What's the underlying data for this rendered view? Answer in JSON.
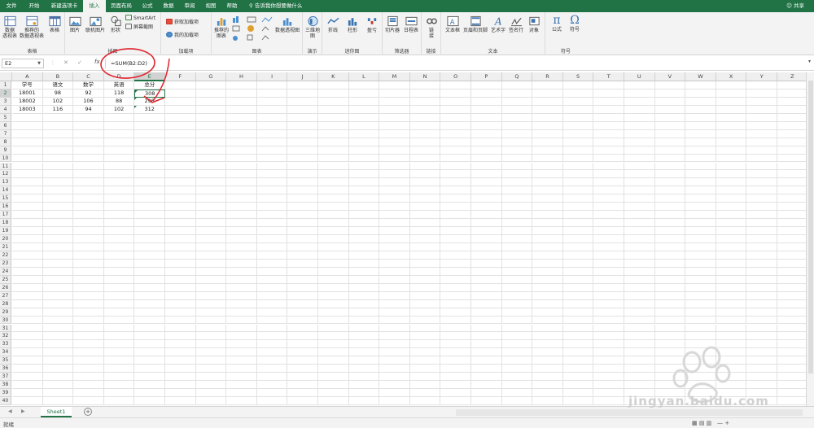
{
  "tabs": [
    {
      "label": "文件",
      "active": false
    },
    {
      "label": "开始",
      "active": false
    },
    {
      "label": "新建选项卡",
      "active": false
    },
    {
      "label": "插入",
      "active": true
    },
    {
      "label": "页面布局",
      "active": false
    },
    {
      "label": "公式",
      "active": false
    },
    {
      "label": "数据",
      "active": false
    },
    {
      "label": "审阅",
      "active": false
    },
    {
      "label": "视图",
      "active": false
    },
    {
      "label": "帮助",
      "active": false
    }
  ],
  "tell_me": "告诉我你想要做什么",
  "share": "共享",
  "ribbon": {
    "groups": {
      "tables": "表格",
      "illustrations": "插图",
      "addins": "加载项",
      "charts": "图表",
      "tours": "演示",
      "sparklines": "迷你图",
      "filters": "筛选器",
      "links": "链接",
      "text": "文本",
      "symbols": "符号"
    },
    "buttons": {
      "pivot_table": "数据\n透视表",
      "recommended_pivot": "推荐的\n数据透视表",
      "table": "表格",
      "pictures": "图片",
      "online_pictures": "联机图片",
      "shapes": "形状",
      "smartart": "SmartArt",
      "screenshot": "屏幕截图",
      "get_addins": "获取加载项",
      "my_addins": "我的加载项",
      "recommended_charts": "推荐的\n图表",
      "pivot_chart": "数据透视图",
      "map_3d": "三维地\n图",
      "line": "折线",
      "column": "柱形",
      "win_loss": "盈亏",
      "slicer": "切片器",
      "timeline": "日程表",
      "link": "链\n接",
      "text_box": "文本框",
      "header_footer": "页眉和页脚",
      "wordart": "艺术字",
      "signature": "签名行",
      "object": "对象",
      "equation": "公式",
      "symbol": "符号"
    }
  },
  "formula_bar": {
    "name_box": "E2",
    "fx": "fx",
    "formula": "=SUM(B2:D2)"
  },
  "columns": [
    "A",
    "B",
    "C",
    "D",
    "E",
    "F",
    "G",
    "H",
    "I",
    "J",
    "K",
    "L",
    "M",
    "N",
    "O",
    "P",
    "Q",
    "R",
    "S",
    "T",
    "U",
    "V",
    "W",
    "X",
    "Y",
    "Z"
  ],
  "selected_column": "E",
  "rows_count": 40,
  "selected_row": 2,
  "cells": [
    [
      "学号",
      "语文",
      "数学",
      "英语",
      "总分"
    ],
    [
      "18001",
      "98",
      "92",
      "118",
      "308"
    ],
    [
      "18002",
      "102",
      "106",
      "88",
      "296"
    ],
    [
      "18003",
      "116",
      "94",
      "102",
      "312"
    ]
  ],
  "sheet_tabs": [
    "Sheet1"
  ],
  "add_sheet": "+",
  "status": "就绪",
  "watermark": "jingyan.baidu.com",
  "colors": {
    "accent": "#217346",
    "annotation": "#e0242c"
  }
}
